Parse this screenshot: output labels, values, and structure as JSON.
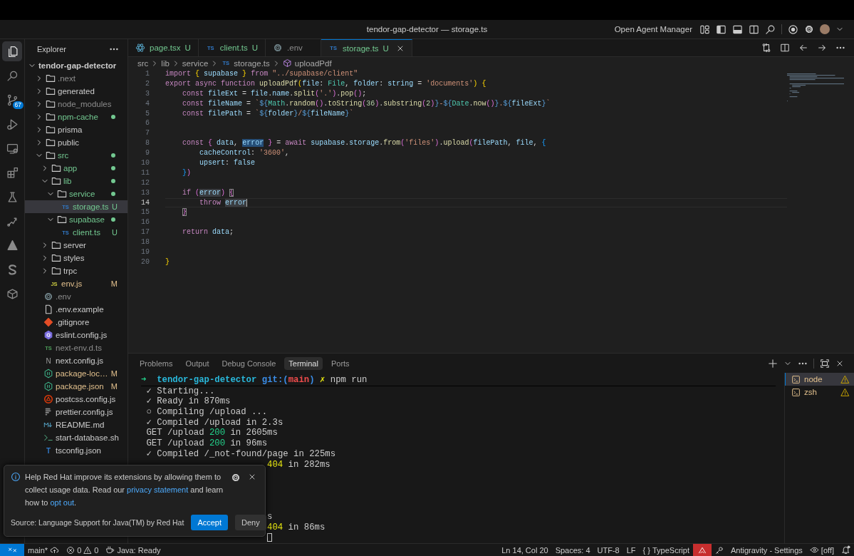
{
  "title_bar": {
    "title": "tendor-gap-detector — storage.ts",
    "agent_button": "Open Agent Manager"
  },
  "activity_bar": [
    {
      "kind": "files",
      "selected": true
    },
    {
      "kind": "search",
      "selected": false
    },
    {
      "kind": "scm",
      "selected": false,
      "badge": "67"
    },
    {
      "kind": "debug",
      "selected": false
    },
    {
      "kind": "remote",
      "selected": false
    },
    {
      "kind": "extensions",
      "selected": false
    },
    {
      "kind": "testing",
      "selected": false
    },
    {
      "kind": "deploy",
      "selected": false
    },
    {
      "kind": "triangle",
      "selected": false
    },
    {
      "kind": "s",
      "selected": false
    },
    {
      "kind": "box",
      "selected": false
    }
  ],
  "explorer": {
    "title": "Explorer",
    "root": {
      "label": "tendor-gap-detector",
      "expanded": true,
      "children": [
        {
          "label": ".next",
          "kind": "folder",
          "expanded": false,
          "color": "#8c8c8c",
          "dot": false,
          "selected": false
        },
        {
          "label": "generated",
          "kind": "folder",
          "expanded": false,
          "color": "#cccccc",
          "dot": false,
          "selected": false
        },
        {
          "label": "node_modules",
          "kind": "folder",
          "expanded": false,
          "color": "#8c8c8c",
          "dot": false,
          "selected": false
        },
        {
          "label": "npm-cache",
          "kind": "folder",
          "expanded": false,
          "color": "#73c991",
          "dot": true,
          "selected": false
        },
        {
          "label": "prisma",
          "kind": "folder",
          "expanded": false,
          "color": "#cccccc",
          "dot": false,
          "selected": false
        },
        {
          "label": "public",
          "kind": "folder",
          "expanded": false,
          "color": "#cccccc",
          "dot": false,
          "selected": false
        },
        {
          "label": "src",
          "kind": "folder",
          "expanded": true,
          "color": "#73c991",
          "dot": true,
          "selected": false,
          "children": [
            {
              "label": "app",
              "kind": "folder",
              "expanded": false,
              "color": "#73c991",
              "dot": true,
              "selected": false
            },
            {
              "label": "lib",
              "kind": "folder",
              "expanded": true,
              "color": "#73c991",
              "dot": true,
              "selected": false,
              "children": [
                {
                  "label": "service",
                  "kind": "folder",
                  "expanded": true,
                  "color": "#73c991",
                  "dot": true,
                  "selected": false,
                  "children": [
                    {
                      "label": "storage.ts",
                      "kind": "ts",
                      "icon_text": "TS",
                      "color": "#73c991",
                      "badge": "U",
                      "dot": false,
                      "selected": true
                    }
                  ]
                },
                {
                  "label": "supabase",
                  "kind": "folder",
                  "expanded": true,
                  "color": "#73c991",
                  "dot": true,
                  "selected": false,
                  "children": [
                    {
                      "label": "client.ts",
                      "kind": "ts",
                      "icon_text": "TS",
                      "color": "#73c991",
                      "badge": "U",
                      "dot": false,
                      "selected": false
                    }
                  ]
                }
              ]
            },
            {
              "label": "server",
              "kind": "folder",
              "expanded": false,
              "color": "#cccccc",
              "dot": false,
              "selected": false
            },
            {
              "label": "styles",
              "kind": "folder",
              "expanded": false,
              "color": "#cccccc",
              "dot": false,
              "selected": false
            },
            {
              "label": "trpc",
              "kind": "folder",
              "expanded": false,
              "color": "#cccccc",
              "dot": false,
              "selected": false
            },
            {
              "label": "env.js",
              "kind": "js",
              "icon_text": "JS",
              "color": "#e2c08d",
              "badge": "M",
              "dot": false,
              "selected": false
            }
          ]
        },
        {
          "label": ".env",
          "kind": "gear",
          "color": "#8c8c8c",
          "dot": false,
          "selected": false
        },
        {
          "label": ".env.example",
          "kind": "doc",
          "color": "#cccccc",
          "dot": false,
          "selected": false
        },
        {
          "label": ".gitignore",
          "kind": "git",
          "color": "#cccccc",
          "dot": false,
          "selected": false
        },
        {
          "label": "eslint.config.js",
          "kind": "eslint",
          "color": "#cccccc",
          "dot": false,
          "selected": false
        },
        {
          "label": "next-env.d.ts",
          "kind": "dts",
          "icon_text": "TS",
          "color": "#8c8c8c",
          "dot": false,
          "selected": false
        },
        {
          "label": "next.config.js",
          "kind": "next",
          "icon_text": "N",
          "color": "#cccccc",
          "dot": false,
          "selected": false
        },
        {
          "label": "package-loc…",
          "kind": "npm",
          "color": "#e2c08d",
          "badge": "M",
          "dot": false,
          "selected": false
        },
        {
          "label": "package.json",
          "kind": "npm",
          "color": "#e2c08d",
          "badge": "M",
          "dot": false,
          "selected": false
        },
        {
          "label": "postcss.config.js",
          "kind": "postcss",
          "color": "#cccccc",
          "dot": false,
          "selected": false
        },
        {
          "label": "prettier.config.js",
          "kind": "prettier",
          "color": "#cccccc",
          "dot": false,
          "selected": false
        },
        {
          "label": "README.md",
          "kind": "md",
          "color": "#cccccc",
          "dot": false,
          "selected": false
        },
        {
          "label": "start-database.sh",
          "kind": "shell",
          "color": "#cccccc",
          "dot": false,
          "selected": false
        },
        {
          "label": "tsconfig.json",
          "kind": "tsconfig",
          "icon_text": "T",
          "color": "#cccccc",
          "dot": false,
          "selected": false
        }
      ]
    }
  },
  "editor": {
    "tabs": [
      {
        "label": "page.tsx",
        "kind": "react",
        "color": "#73c991",
        "badge": "U",
        "selected": false
      },
      {
        "label": "client.ts",
        "kind": "ts",
        "icon_text": "TS",
        "color": "#73c991",
        "badge": "U",
        "selected": false
      },
      {
        "label": ".env",
        "kind": "gear",
        "color": "#8c8c8c",
        "selected": false
      },
      {
        "label": "storage.ts",
        "kind": "ts",
        "icon_text": "TS",
        "color": "#73c991",
        "badge": "U",
        "selected": true
      }
    ],
    "breadcrumb": [
      {
        "label": "src",
        "kind": "folder"
      },
      {
        "label": "lib",
        "kind": "folder"
      },
      {
        "label": "service",
        "kind": "folder"
      },
      {
        "label": "storage.ts",
        "kind": "ts",
        "icon_text": "TS"
      },
      {
        "label": "uploadPdf",
        "kind": "symbol"
      }
    ],
    "lines": [
      {
        "number": "1",
        "current": false,
        "text": "import { supabase } from \"../supabase/client\""
      },
      {
        "number": "2",
        "current": false,
        "text": "export async function uploadPdf(file: File, folder: string = 'documents') {"
      },
      {
        "number": "3",
        "current": false,
        "text": "    const fileExt = file.name.split('.').pop();"
      },
      {
        "number": "4",
        "current": false,
        "text": "    const fileName = `${Math.random().toString(36).substring(2)}-${Date.now()}.${fileExt}`"
      },
      {
        "number": "5",
        "current": false,
        "text": "    const filePath = `${folder}/${fileName}`"
      },
      {
        "number": "6",
        "current": false
      },
      {
        "number": "7",
        "current": false
      },
      {
        "number": "8",
        "current": false,
        "text": "    const { data, error } = await supabase.storage.from('files').upload(filePath, file, {"
      },
      {
        "number": "9",
        "current": false,
        "text": "        cacheControl: '3600',"
      },
      {
        "number": "10",
        "current": false,
        "text": "        upsert: false"
      },
      {
        "number": "11",
        "current": false,
        "text": "    })"
      },
      {
        "number": "12",
        "current": false
      },
      {
        "number": "13",
        "current": false,
        "text": "    if (error) {"
      },
      {
        "number": "14",
        "current": true,
        "text": "        throw error"
      },
      {
        "number": "15",
        "current": false,
        "text": "    }"
      },
      {
        "number": "16",
        "current": false
      },
      {
        "number": "17",
        "current": false,
        "text": "    return data;"
      },
      {
        "number": "18",
        "current": false
      },
      {
        "number": "19",
        "current": false
      },
      {
        "number": "20",
        "current": false,
        "text": "}"
      }
    ]
  },
  "panel": {
    "tabs": [
      {
        "label": "Problems",
        "selected": false
      },
      {
        "label": "Output",
        "selected": false
      },
      {
        "label": "Debug Console",
        "selected": false
      },
      {
        "label": "Terminal",
        "selected": true
      },
      {
        "label": "Ports",
        "selected": false
      }
    ],
    "terminal": {
      "lines": [
        {
          "kind": "prompt",
          "arrow": "➜",
          "directory": "tendor-gap-detector",
          "git": "git:(main)",
          "dirty": "✗",
          "command": "npm run"
        },
        {
          "kind": "line",
          "text": "✓ Starting..."
        },
        {
          "kind": "line",
          "text": "✓ Ready in 870ms"
        },
        {
          "kind": "line",
          "text": "○ Compiling /upload ..."
        },
        {
          "kind": "line",
          "text": "✓ Compiled /upload in 2.3s"
        },
        {
          "kind": "line",
          "text": "GET /upload 200 in 2605ms"
        },
        {
          "kind": "line",
          "text": "GET /upload 200 in 96ms"
        },
        {
          "kind": "line",
          "text": "✓ Compiled /_not-found/page in 225ms"
        },
        {
          "kind": "tail",
          "text": "404 in 282ms"
        },
        {
          "kind": "covered"
        },
        {
          "kind": "covered"
        },
        {
          "kind": "covered"
        },
        {
          "kind": "covered"
        },
        {
          "kind": "tail",
          "text": "s"
        },
        {
          "kind": "tail",
          "text": "404 in 86ms"
        },
        {
          "kind": "cursor"
        }
      ]
    },
    "sessions": [
      {
        "label": "node",
        "selected": true,
        "warning": true
      },
      {
        "label": "zsh",
        "selected": false,
        "warning": true
      }
    ]
  },
  "notification": {
    "message": {
      "before": "Help Red Hat improve its extensions by allowing them to collect usage data. Read our ",
      "privacy_link": "privacy statement",
      "middle": " and learn how to ",
      "opt_out_link": "opt out",
      "after": "."
    },
    "source": "Source: Language Support for Java(TM) by Red Hat",
    "buttons": [
      {
        "label": "Accept",
        "primary": true
      },
      {
        "label": "Deny",
        "primary": false
      }
    ]
  },
  "status_bar": {
    "branch": "main*",
    "errors": "0",
    "warnings": "0",
    "java": "Java: Ready",
    "position": "Ln 14, Col 20",
    "indent": "Spaces: 4",
    "encoding": "UTF-8",
    "eol": "LF",
    "language_icon": "{ }",
    "language": "TypeScript",
    "antigravity": "Antigravity - Settings",
    "preview": "[off]"
  }
}
